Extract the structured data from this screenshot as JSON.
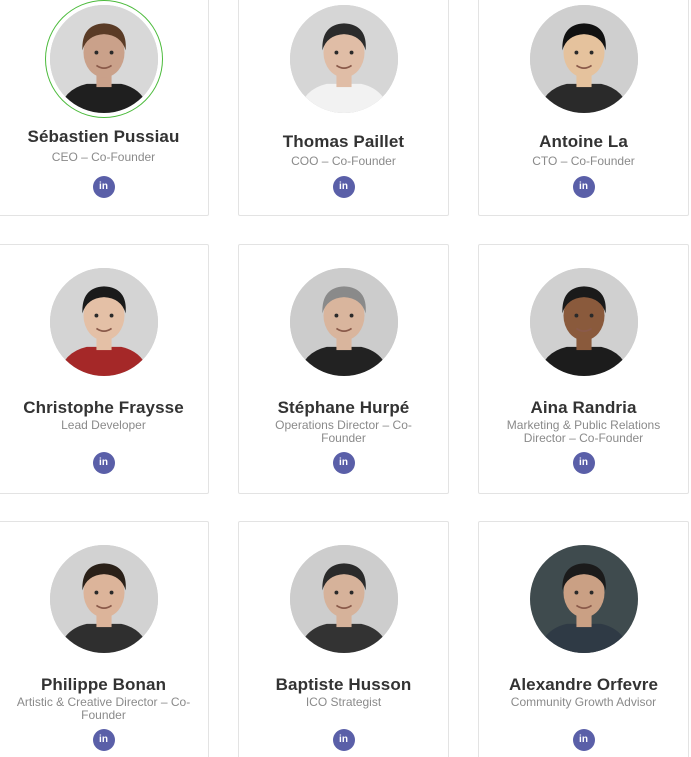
{
  "team": [
    {
      "name": "Sébastien Pussiau",
      "role": "CEO – Co-Founder",
      "skin": "#caa18a",
      "hair": "#5a3b26",
      "shirt": "#1f1f1f",
      "bg": "#d8d8d8",
      "social_icon": "linkedin-icon",
      "social_label": "in"
    },
    {
      "name": "Thomas Paillet",
      "role": "COO – Co-Founder",
      "skin": "#e0bda6",
      "hair": "#2b2b2b",
      "shirt": "#f2f2f2",
      "bg": "#d6d6d6",
      "social_icon": "linkedin-icon",
      "social_label": "in"
    },
    {
      "name": "Antoine La",
      "role": "CTO – Co-Founder",
      "skin": "#e5c29d",
      "hair": "#111111",
      "shirt": "#2a2a2a",
      "bg": "#cfcfcf",
      "social_icon": "linkedin-icon",
      "social_label": "in"
    },
    {
      "name": "Christophe Fraysse",
      "role": "Lead Developer",
      "skin": "#e4c0a6",
      "hair": "#1a1a1a",
      "shirt": "#a52828",
      "bg": "#d4d4d4",
      "social_icon": "linkedin-icon",
      "social_label": "in"
    },
    {
      "name": "Stéphane Hurpé",
      "role": "Operations Director – Co-Founder",
      "skin": "#d9b59d",
      "hair": "#8a8a8a",
      "shirt": "#222222",
      "bg": "#cccccc",
      "social_icon": "linkedin-icon",
      "social_label": "in"
    },
    {
      "name": "Aina Randria",
      "role": "Marketing & Public Relations Director – Co-Founder",
      "skin": "#8a5a3c",
      "hair": "#1a1a1a",
      "shirt": "#1c1c1c",
      "bg": "#d0d0d0",
      "social_icon": "linkedin-icon",
      "social_label": "in"
    },
    {
      "name": "Philippe Bonan",
      "role": "Artistic & Creative Director – Co-Founder",
      "skin": "#dcb49a",
      "hair": "#2a2018",
      "shirt": "#2f2f2f",
      "bg": "#d2d2d2",
      "social_icon": "linkedin-icon",
      "social_label": "in"
    },
    {
      "name": "Baptiste Husson",
      "role": "ICO Strategist",
      "skin": "#d6b29a",
      "hair": "#2a2a2a",
      "shirt": "#333333",
      "bg": "#cdcdcd",
      "social_icon": "linkedin-icon",
      "social_label": "in"
    },
    {
      "name": "Alexandre Orfevre",
      "role": "Community Growth Advisor",
      "skin": "#caa084",
      "hair": "#1b1b1b",
      "shirt": "#2f3a45",
      "bg": "#3f4b4e",
      "social_icon": "linkedin-icon",
      "social_label": "in"
    }
  ],
  "colors": {
    "linkedin": "#5a5fa8",
    "highlight_ring": "#4cbb3c",
    "name": "#333333",
    "role": "#8a8a8a"
  }
}
